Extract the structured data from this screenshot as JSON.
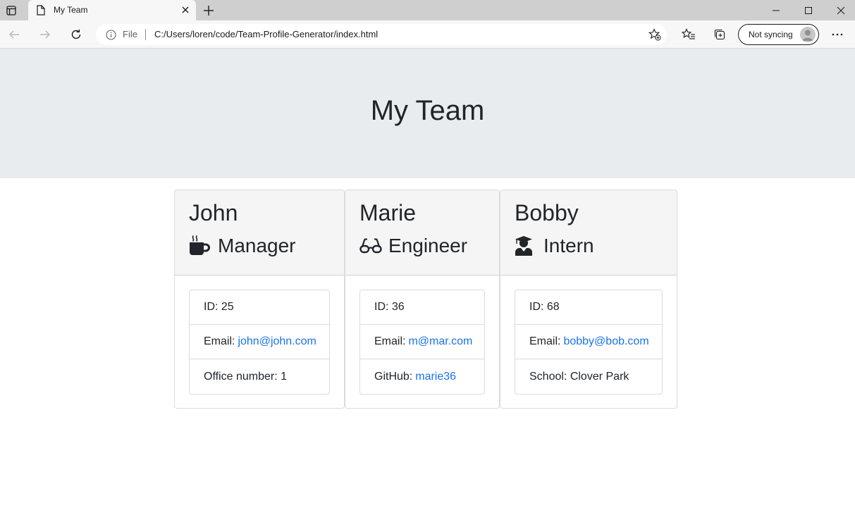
{
  "browser": {
    "tab_title": "My Team",
    "address_prefix": "File",
    "url": "C:/Users/loren/code/Team-Profile-Generator/index.html",
    "profile_label": "Not syncing"
  },
  "page": {
    "title": "My Team"
  },
  "team": [
    {
      "name": "John",
      "role": "Manager",
      "role_icon": "mug-icon",
      "id_label": "ID: 25",
      "email_label": "Email:",
      "email": "john@john.com",
      "extra_label": "Office number: 1",
      "extra_link": ""
    },
    {
      "name": "Marie",
      "role": "Engineer",
      "role_icon": "glasses-icon",
      "id_label": "ID: 36",
      "email_label": "Email:",
      "email": "m@mar.com",
      "extra_label": "GitHub:",
      "extra_link": "marie36"
    },
    {
      "name": "Bobby",
      "role": "Intern",
      "role_icon": "graduate-icon",
      "id_label": "ID: 68",
      "email_label": "Email:",
      "email": "bobby@bob.com",
      "extra_label": "School: Clover Park",
      "extra_link": ""
    }
  ],
  "colors": {
    "link": "#1a73e8",
    "jumbotron_bg": "#e9ecef",
    "card_header_bg": "#f5f5f5"
  }
}
